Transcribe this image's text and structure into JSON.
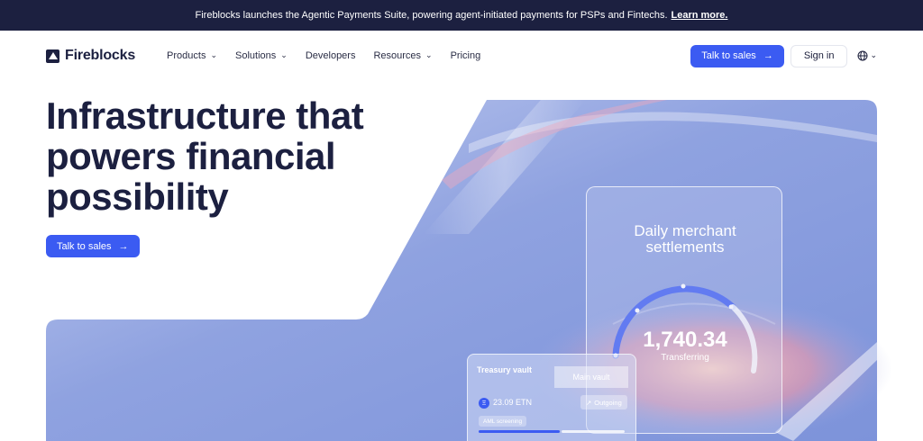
{
  "banner": {
    "text": "Fireblocks launches the Agentic Payments Suite, powering agent-initiated payments for PSPs and Fintechs.",
    "link": "Learn more."
  },
  "nav": {
    "logo": "Fireblocks",
    "items": [
      {
        "label": "Products",
        "has_dropdown": true
      },
      {
        "label": "Solutions",
        "has_dropdown": true
      },
      {
        "label": "Developers",
        "has_dropdown": false
      },
      {
        "label": "Resources",
        "has_dropdown": true
      },
      {
        "label": "Pricing",
        "has_dropdown": false
      }
    ],
    "cta": "Talk to sales",
    "signin": "Sign in",
    "language_icon": "globe-icon"
  },
  "hero": {
    "title_line1": "Infrastructure that",
    "title_line2": "powers financial",
    "title_line3": "possibility",
    "cta": "Talk to sales"
  },
  "card": {
    "title_line1": "Daily merchant",
    "title_line2": "settlements",
    "value": "1,740.34",
    "status": "Transferring"
  },
  "vault": {
    "from": "Treasury vault",
    "to": "Main vault",
    "amount": "23.09 ETN",
    "direction": "Outgoing",
    "tag": "AML screening"
  },
  "colors": {
    "banner_bg": "#1c2040",
    "accent": "#3b5bf2",
    "text_dark": "#1c2040"
  }
}
